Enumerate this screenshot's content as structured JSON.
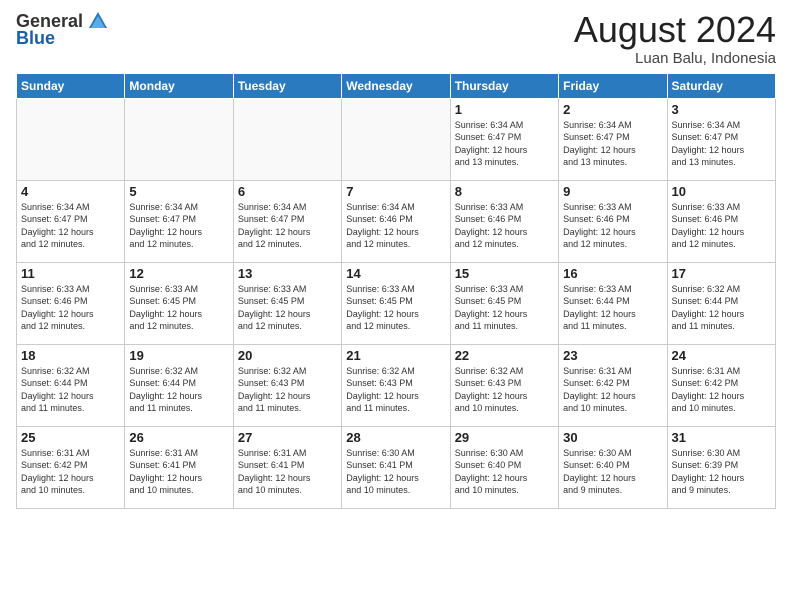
{
  "logo": {
    "general": "General",
    "blue": "Blue"
  },
  "title": "August 2024",
  "location": "Luan Balu, Indonesia",
  "days": [
    "Sunday",
    "Monday",
    "Tuesday",
    "Wednesday",
    "Thursday",
    "Friday",
    "Saturday"
  ],
  "weeks": [
    [
      {
        "day": "",
        "info": ""
      },
      {
        "day": "",
        "info": ""
      },
      {
        "day": "",
        "info": ""
      },
      {
        "day": "",
        "info": ""
      },
      {
        "day": "1",
        "info": "Sunrise: 6:34 AM\nSunset: 6:47 PM\nDaylight: 12 hours\nand 13 minutes."
      },
      {
        "day": "2",
        "info": "Sunrise: 6:34 AM\nSunset: 6:47 PM\nDaylight: 12 hours\nand 13 minutes."
      },
      {
        "day": "3",
        "info": "Sunrise: 6:34 AM\nSunset: 6:47 PM\nDaylight: 12 hours\nand 13 minutes."
      }
    ],
    [
      {
        "day": "4",
        "info": "Sunrise: 6:34 AM\nSunset: 6:47 PM\nDaylight: 12 hours\nand 12 minutes."
      },
      {
        "day": "5",
        "info": "Sunrise: 6:34 AM\nSunset: 6:47 PM\nDaylight: 12 hours\nand 12 minutes."
      },
      {
        "day": "6",
        "info": "Sunrise: 6:34 AM\nSunset: 6:47 PM\nDaylight: 12 hours\nand 12 minutes."
      },
      {
        "day": "7",
        "info": "Sunrise: 6:34 AM\nSunset: 6:46 PM\nDaylight: 12 hours\nand 12 minutes."
      },
      {
        "day": "8",
        "info": "Sunrise: 6:33 AM\nSunset: 6:46 PM\nDaylight: 12 hours\nand 12 minutes."
      },
      {
        "day": "9",
        "info": "Sunrise: 6:33 AM\nSunset: 6:46 PM\nDaylight: 12 hours\nand 12 minutes."
      },
      {
        "day": "10",
        "info": "Sunrise: 6:33 AM\nSunset: 6:46 PM\nDaylight: 12 hours\nand 12 minutes."
      }
    ],
    [
      {
        "day": "11",
        "info": "Sunrise: 6:33 AM\nSunset: 6:46 PM\nDaylight: 12 hours\nand 12 minutes."
      },
      {
        "day": "12",
        "info": "Sunrise: 6:33 AM\nSunset: 6:45 PM\nDaylight: 12 hours\nand 12 minutes."
      },
      {
        "day": "13",
        "info": "Sunrise: 6:33 AM\nSunset: 6:45 PM\nDaylight: 12 hours\nand 12 minutes."
      },
      {
        "day": "14",
        "info": "Sunrise: 6:33 AM\nSunset: 6:45 PM\nDaylight: 12 hours\nand 12 minutes."
      },
      {
        "day": "15",
        "info": "Sunrise: 6:33 AM\nSunset: 6:45 PM\nDaylight: 12 hours\nand 11 minutes."
      },
      {
        "day": "16",
        "info": "Sunrise: 6:33 AM\nSunset: 6:44 PM\nDaylight: 12 hours\nand 11 minutes."
      },
      {
        "day": "17",
        "info": "Sunrise: 6:32 AM\nSunset: 6:44 PM\nDaylight: 12 hours\nand 11 minutes."
      }
    ],
    [
      {
        "day": "18",
        "info": "Sunrise: 6:32 AM\nSunset: 6:44 PM\nDaylight: 12 hours\nand 11 minutes."
      },
      {
        "day": "19",
        "info": "Sunrise: 6:32 AM\nSunset: 6:44 PM\nDaylight: 12 hours\nand 11 minutes."
      },
      {
        "day": "20",
        "info": "Sunrise: 6:32 AM\nSunset: 6:43 PM\nDaylight: 12 hours\nand 11 minutes."
      },
      {
        "day": "21",
        "info": "Sunrise: 6:32 AM\nSunset: 6:43 PM\nDaylight: 12 hours\nand 11 minutes."
      },
      {
        "day": "22",
        "info": "Sunrise: 6:32 AM\nSunset: 6:43 PM\nDaylight: 12 hours\nand 10 minutes."
      },
      {
        "day": "23",
        "info": "Sunrise: 6:31 AM\nSunset: 6:42 PM\nDaylight: 12 hours\nand 10 minutes."
      },
      {
        "day": "24",
        "info": "Sunrise: 6:31 AM\nSunset: 6:42 PM\nDaylight: 12 hours\nand 10 minutes."
      }
    ],
    [
      {
        "day": "25",
        "info": "Sunrise: 6:31 AM\nSunset: 6:42 PM\nDaylight: 12 hours\nand 10 minutes."
      },
      {
        "day": "26",
        "info": "Sunrise: 6:31 AM\nSunset: 6:41 PM\nDaylight: 12 hours\nand 10 minutes."
      },
      {
        "day": "27",
        "info": "Sunrise: 6:31 AM\nSunset: 6:41 PM\nDaylight: 12 hours\nand 10 minutes."
      },
      {
        "day": "28",
        "info": "Sunrise: 6:30 AM\nSunset: 6:41 PM\nDaylight: 12 hours\nand 10 minutes."
      },
      {
        "day": "29",
        "info": "Sunrise: 6:30 AM\nSunset: 6:40 PM\nDaylight: 12 hours\nand 10 minutes."
      },
      {
        "day": "30",
        "info": "Sunrise: 6:30 AM\nSunset: 6:40 PM\nDaylight: 12 hours\nand 9 minutes."
      },
      {
        "day": "31",
        "info": "Sunrise: 6:30 AM\nSunset: 6:39 PM\nDaylight: 12 hours\nand 9 minutes."
      }
    ]
  ]
}
